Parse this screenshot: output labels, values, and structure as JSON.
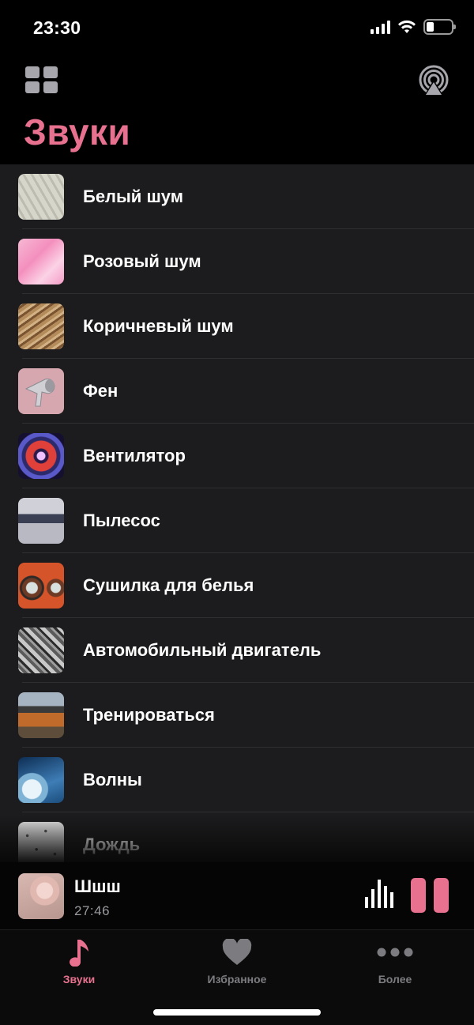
{
  "status_bar": {
    "time": "23:30",
    "icons": [
      "cellular-signal-icon",
      "wifi-icon",
      "battery-icon"
    ]
  },
  "header": {
    "title": "Звуки",
    "left_icon": "grid-icon",
    "right_icon": "airplay-icon",
    "accent_color": "#e8718f"
  },
  "sounds": [
    {
      "label": "Белый шум"
    },
    {
      "label": "Розовый шум"
    },
    {
      "label": "Коричневый шум"
    },
    {
      "label": "Фен"
    },
    {
      "label": "Вентилятор"
    },
    {
      "label": "Пылесос"
    },
    {
      "label": "Сушилка для белья"
    },
    {
      "label": "Автомобильный двигатель"
    },
    {
      "label": "Тренироваться"
    },
    {
      "label": "Волны"
    },
    {
      "label": "Дождь"
    }
  ],
  "player": {
    "title": "Шшш",
    "time": "27:46",
    "icons": [
      "equalizer-icon",
      "pause-icon"
    ]
  },
  "tabs": [
    {
      "label": "Звуки",
      "icon": "music-note-icon",
      "active": true
    },
    {
      "label": "Избранное",
      "icon": "heart-icon",
      "active": false
    },
    {
      "label": "Более",
      "icon": "more-dots-icon",
      "active": false
    }
  ]
}
